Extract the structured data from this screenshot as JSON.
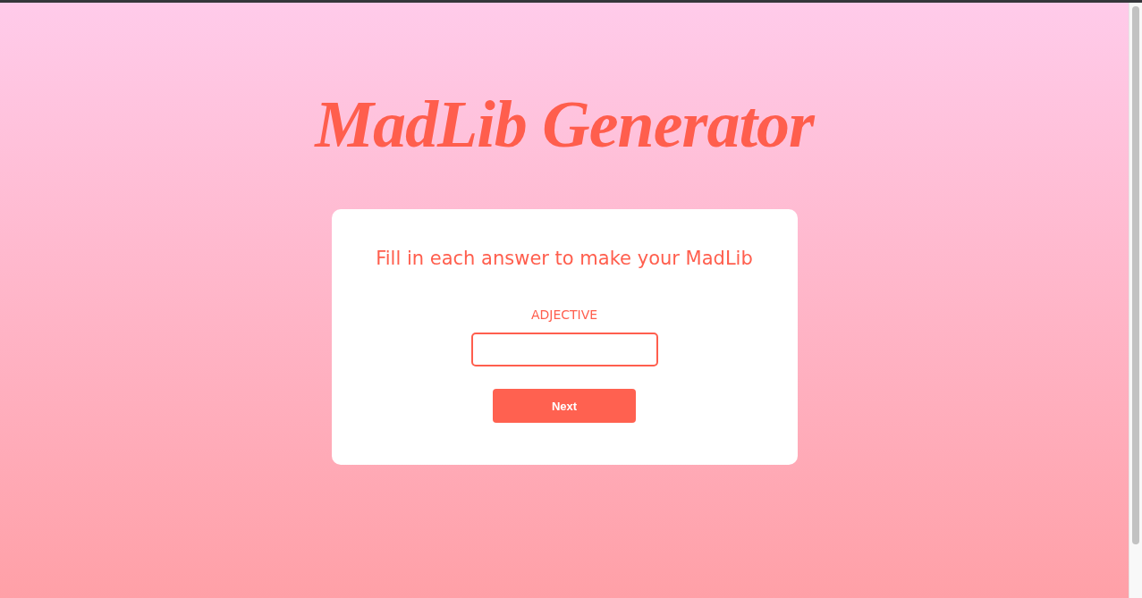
{
  "title": "MadLib Generator",
  "card": {
    "heading": "Fill in each answer to make your MadLib",
    "field": {
      "label": "ADJECTIVE"
    },
    "button": {
      "label": "Next"
    }
  }
}
